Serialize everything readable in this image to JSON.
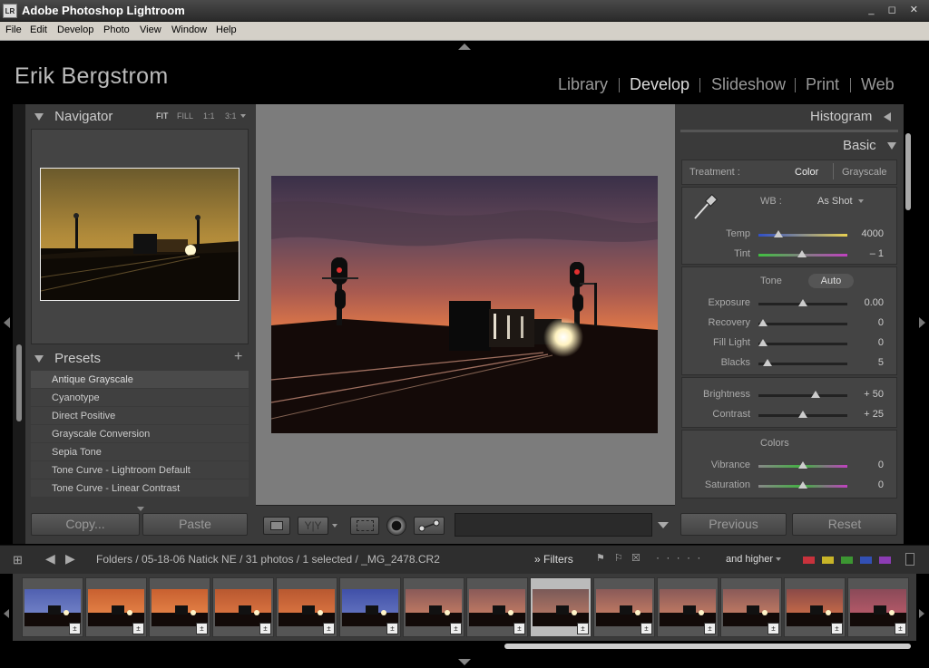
{
  "window": {
    "title": "Adobe Photoshop Lightroom",
    "icon_text": "LR",
    "controls": "_ ◻ ✕"
  },
  "menu": [
    "File",
    "Edit",
    "Develop",
    "Photo",
    "View",
    "Window",
    "Help"
  ],
  "identity_plate": "Erik Bergstrom",
  "modules": [
    {
      "label": "Library",
      "active": false
    },
    {
      "label": "Develop",
      "active": true
    },
    {
      "label": "Slideshow",
      "active": false
    },
    {
      "label": "Print",
      "active": false
    },
    {
      "label": "Web",
      "active": false
    }
  ],
  "navigator": {
    "title": "Navigator",
    "zoom_options": [
      "FIT",
      "FILL",
      "1:1",
      "3:1"
    ],
    "active_zoom": "FIT"
  },
  "presets": {
    "title": "Presets",
    "add": "+",
    "items": [
      "Antique Grayscale",
      "Cyanotype",
      "Direct Positive",
      "Grayscale Conversion",
      "Sepia Tone",
      "Tone Curve - Lightroom Default",
      "Tone Curve - Linear Contrast"
    ]
  },
  "left_buttons": {
    "copy": "Copy...",
    "paste": "Paste"
  },
  "right_panel": {
    "histogram_title": "Histogram",
    "basic_title": "Basic",
    "treatment_label": "Treatment :",
    "treatment_color": "Color",
    "treatment_grayscale": "Grayscale",
    "wb_label": "WB :",
    "wb_value": "As Shot",
    "tone_label": "Tone",
    "auto_label": "Auto",
    "colors_label": "Colors",
    "sliders": [
      {
        "label": "Temp",
        "value": "4000",
        "pos": 0.22
      },
      {
        "label": "Tint",
        "value": "– 1",
        "pos": 0.49
      },
      {
        "label": "Exposure",
        "value": "0.00",
        "pos": 0.5
      },
      {
        "label": "Recovery",
        "value": "0",
        "pos": 0.05
      },
      {
        "label": "Fill Light",
        "value": "0",
        "pos": 0.05
      },
      {
        "label": "Blacks",
        "value": "5",
        "pos": 0.1
      },
      {
        "label": "Brightness",
        "value": "+ 50",
        "pos": 0.64
      },
      {
        "label": "Contrast",
        "value": "+ 25",
        "pos": 0.5
      },
      {
        "label": "Vibrance",
        "value": "0",
        "pos": 0.5
      },
      {
        "label": "Saturation",
        "value": "0",
        "pos": 0.5
      }
    ]
  },
  "right_buttons": {
    "previous": "Previous",
    "reset": "Reset"
  },
  "filmbar": {
    "breadcrumb": "Folders / 05-18-06 Natick NE / 31 photos / 1 selected / _MG_2478.CR2",
    "filters_label": "Filters",
    "dots": "· · · · ·",
    "and_higher": "and higher",
    "label_colors": [
      "#c8323c",
      "#c8b428",
      "#3c9632",
      "#3250b4",
      "#8c3cb4"
    ]
  },
  "filmstrip": {
    "count": 14,
    "selected_index": 8
  }
}
